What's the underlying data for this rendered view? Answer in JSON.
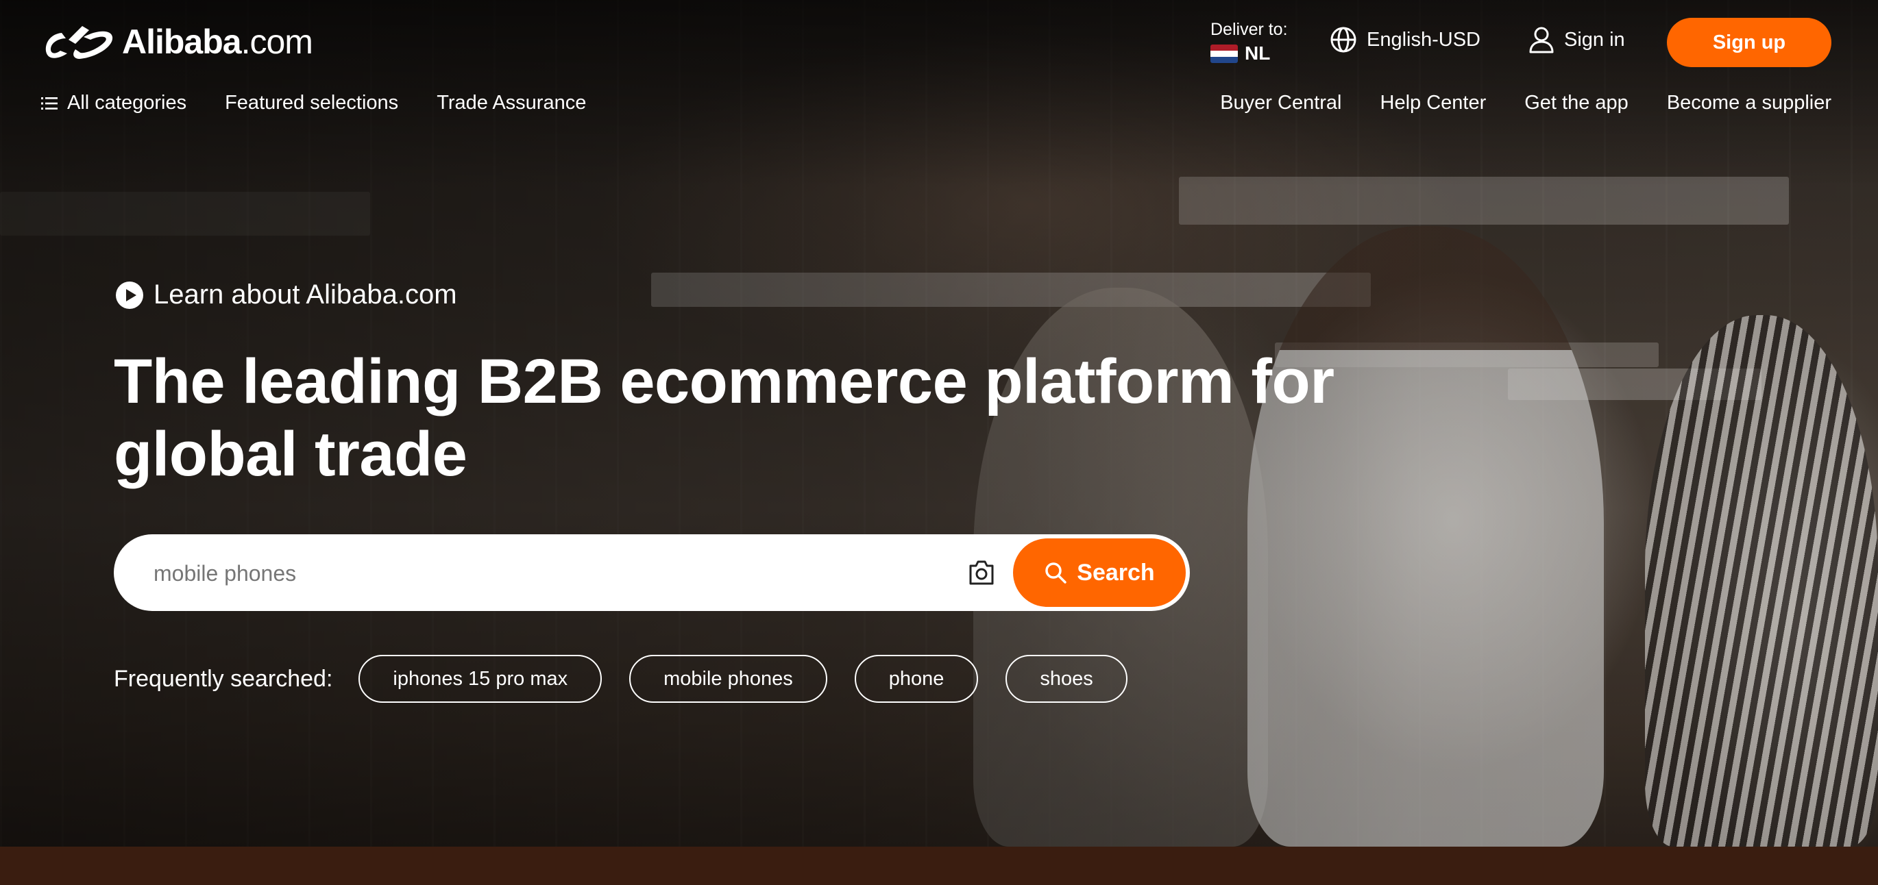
{
  "brand": {
    "name": "Alibaba",
    "domain_suffix": ".com",
    "accent": "#ff6600"
  },
  "header": {
    "deliver_label": "Deliver to:",
    "deliver_country": "NL",
    "language_currency": "English-USD",
    "sign_in": "Sign in",
    "sign_up": "Sign up"
  },
  "nav": {
    "left": [
      "All categories",
      "Featured selections",
      "Trade Assurance"
    ],
    "right": [
      "Buyer Central",
      "Help Center",
      "Get the app",
      "Become a supplier"
    ]
  },
  "hero": {
    "learn_link": "Learn about Alibaba.com",
    "headline": "The leading B2B ecommerce platform for global trade"
  },
  "search": {
    "placeholder": "mobile phones",
    "button": "Search"
  },
  "frequent": {
    "label": "Frequently searched:",
    "items": [
      "iphones 15 pro max",
      "mobile phones",
      "phone",
      "shoes"
    ]
  },
  "icons": {
    "logo": "alibaba-logo-icon",
    "globe": "globe-icon",
    "user": "user-icon",
    "menu": "menu-icon",
    "play": "play-icon",
    "camera": "camera-icon",
    "search": "search-icon",
    "flag": "netherlands-flag-icon"
  }
}
